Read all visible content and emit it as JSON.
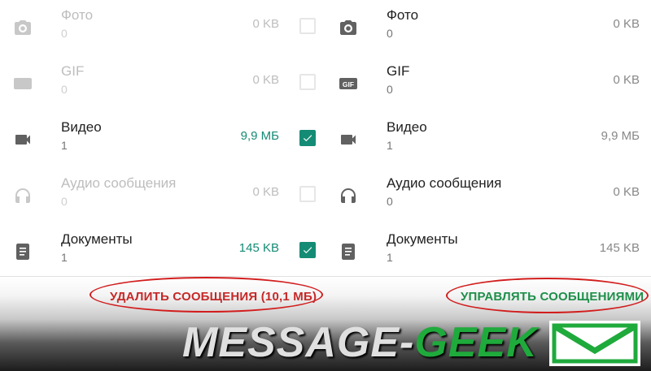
{
  "left_panel": {
    "rows": [
      {
        "title": "Фото",
        "count": "0",
        "size": "0 KB",
        "icon": "camera-icon",
        "checked": false,
        "enabled": false
      },
      {
        "title": "GIF",
        "count": "0",
        "size": "0 KB",
        "icon": "gif-icon",
        "checked": false,
        "enabled": false
      },
      {
        "title": "Видео",
        "count": "1",
        "size": "9,9 МБ",
        "icon": "videocam-icon",
        "checked": true,
        "enabled": true
      },
      {
        "title": "Аудио сообщения",
        "count": "0",
        "size": "0 KB",
        "icon": "headphones-icon",
        "checked": false,
        "enabled": false
      },
      {
        "title": "Документы",
        "count": "1",
        "size": "145 KB",
        "icon": "document-icon",
        "checked": true,
        "enabled": true
      }
    ]
  },
  "right_panel": {
    "rows": [
      {
        "title": "Фото",
        "count": "0",
        "size": "0 KB",
        "icon": "camera-icon"
      },
      {
        "title": "GIF",
        "count": "0",
        "size": "0 KB",
        "icon": "gif-icon"
      },
      {
        "title": "Видео",
        "count": "1",
        "size": "9,9 МБ",
        "icon": "videocam-icon"
      },
      {
        "title": "Аудио сообщения",
        "count": "0",
        "size": "0 KB",
        "icon": "headphones-icon"
      },
      {
        "title": "Документы",
        "count": "1",
        "size": "145 KB",
        "icon": "document-icon"
      }
    ]
  },
  "actions": {
    "delete_label": "УДАЛИТЬ СООБЩЕНИЯ (10,1 МБ)",
    "manage_label": "УПРАВЛЯТЬ СООБЩЕНИЯМИ"
  },
  "watermark": {
    "part1": "MESSAGE-",
    "part2": "GEEK"
  },
  "colors": {
    "accent": "#148b75",
    "delete_text": "#c62828",
    "manage_text": "#1e8f4a",
    "highlight_ellipse": "#d21d1d",
    "brand_green": "#1faa3c"
  }
}
